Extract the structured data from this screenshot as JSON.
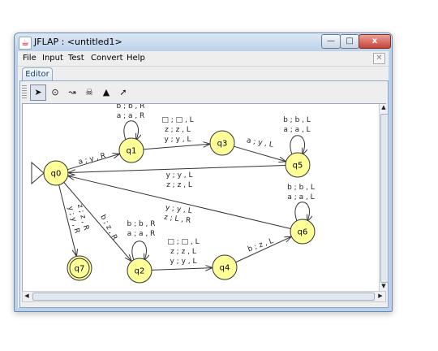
{
  "window": {
    "title": "JFLAP : <untitled1>",
    "buttons": {
      "minimize": "—",
      "maximize": "□",
      "close": "x"
    }
  },
  "menu": [
    {
      "label": "File"
    },
    {
      "label": "Input"
    },
    {
      "label": "Test"
    },
    {
      "label": "Convert"
    },
    {
      "label": "Help"
    }
  ],
  "tab": {
    "label": "Editor"
  },
  "toolbar": {
    "tools": [
      {
        "name": "attribute-editor-tool",
        "icon": "pointer-icon",
        "glyph": "➤",
        "active": true
      },
      {
        "name": "state-creator-tool",
        "icon": "state-circle-icon",
        "glyph": "⊙",
        "active": false
      },
      {
        "name": "transition-creator-tool",
        "icon": "arrow-icon",
        "glyph": "↝",
        "active": false
      },
      {
        "name": "deleter-tool",
        "icon": "skull-icon",
        "glyph": "☠",
        "active": false
      },
      {
        "name": "undo-tool",
        "icon": "car-icon",
        "glyph": "▲",
        "active": false
      },
      {
        "name": "redo-tool",
        "icon": "diagonal-arrow-icon",
        "glyph": "➚",
        "active": false
      }
    ]
  },
  "automaton": {
    "colors": {
      "state_fill": "#ffff99",
      "state_stroke": "#333333",
      "edge": "#333333"
    },
    "states": [
      {
        "id": "q0",
        "label": "q0",
        "initial": true,
        "final": false
      },
      {
        "id": "q1",
        "label": "q1",
        "initial": false,
        "final": false
      },
      {
        "id": "q3",
        "label": "q3",
        "initial": false,
        "final": false
      },
      {
        "id": "q5",
        "label": "q5",
        "initial": false,
        "final": false
      },
      {
        "id": "q6",
        "label": "q6",
        "initial": false,
        "final": false
      },
      {
        "id": "q7",
        "label": "q7",
        "initial": false,
        "final": true
      },
      {
        "id": "q2",
        "label": "q2",
        "initial": false,
        "final": false
      },
      {
        "id": "q4",
        "label": "q4",
        "initial": false,
        "final": false
      }
    ],
    "transitions": [
      {
        "from": "q0",
        "to": "q1",
        "labels": [
          "a ; y , R"
        ]
      },
      {
        "from": "q1",
        "to": "q1",
        "labels": [
          "b ; b , R",
          "a ; a , R"
        ]
      },
      {
        "from": "q1",
        "to": "q3",
        "labels": [
          "□ ; □ , L",
          "z ; z , L",
          "y ; y , L"
        ]
      },
      {
        "from": "q3",
        "to": "q5",
        "labels": [
          "a ; y , L"
        ]
      },
      {
        "from": "q5",
        "to": "q5",
        "labels": [
          "b ; b , L",
          "a ; a , L"
        ]
      },
      {
        "from": "q5",
        "to": "q0",
        "labels": [
          "y ; y , L",
          "z ; z , L"
        ]
      },
      {
        "from": "q6",
        "to": "q6",
        "labels": [
          "b ; b , L",
          "a ; a , L"
        ]
      },
      {
        "from": "q6",
        "to": "q0",
        "labels": [
          "y ; y , L",
          "z ; L , R"
        ]
      },
      {
        "from": "q0",
        "to": "q7",
        "labels": [
          "z ; z , R",
          "y ; y , R"
        ]
      },
      {
        "from": "q0",
        "to": "q2",
        "labels": [
          "b ; z , R"
        ]
      },
      {
        "from": "q2",
        "to": "q2",
        "labels": [
          "b ; b , R",
          "a ; a , R"
        ]
      },
      {
        "from": "q2",
        "to": "q4",
        "labels": [
          "□ ; □ , L",
          "z ; z , L",
          "y ; y , L"
        ]
      },
      {
        "from": "q4",
        "to": "q6",
        "labels": [
          "b ; z , L"
        ]
      }
    ]
  }
}
